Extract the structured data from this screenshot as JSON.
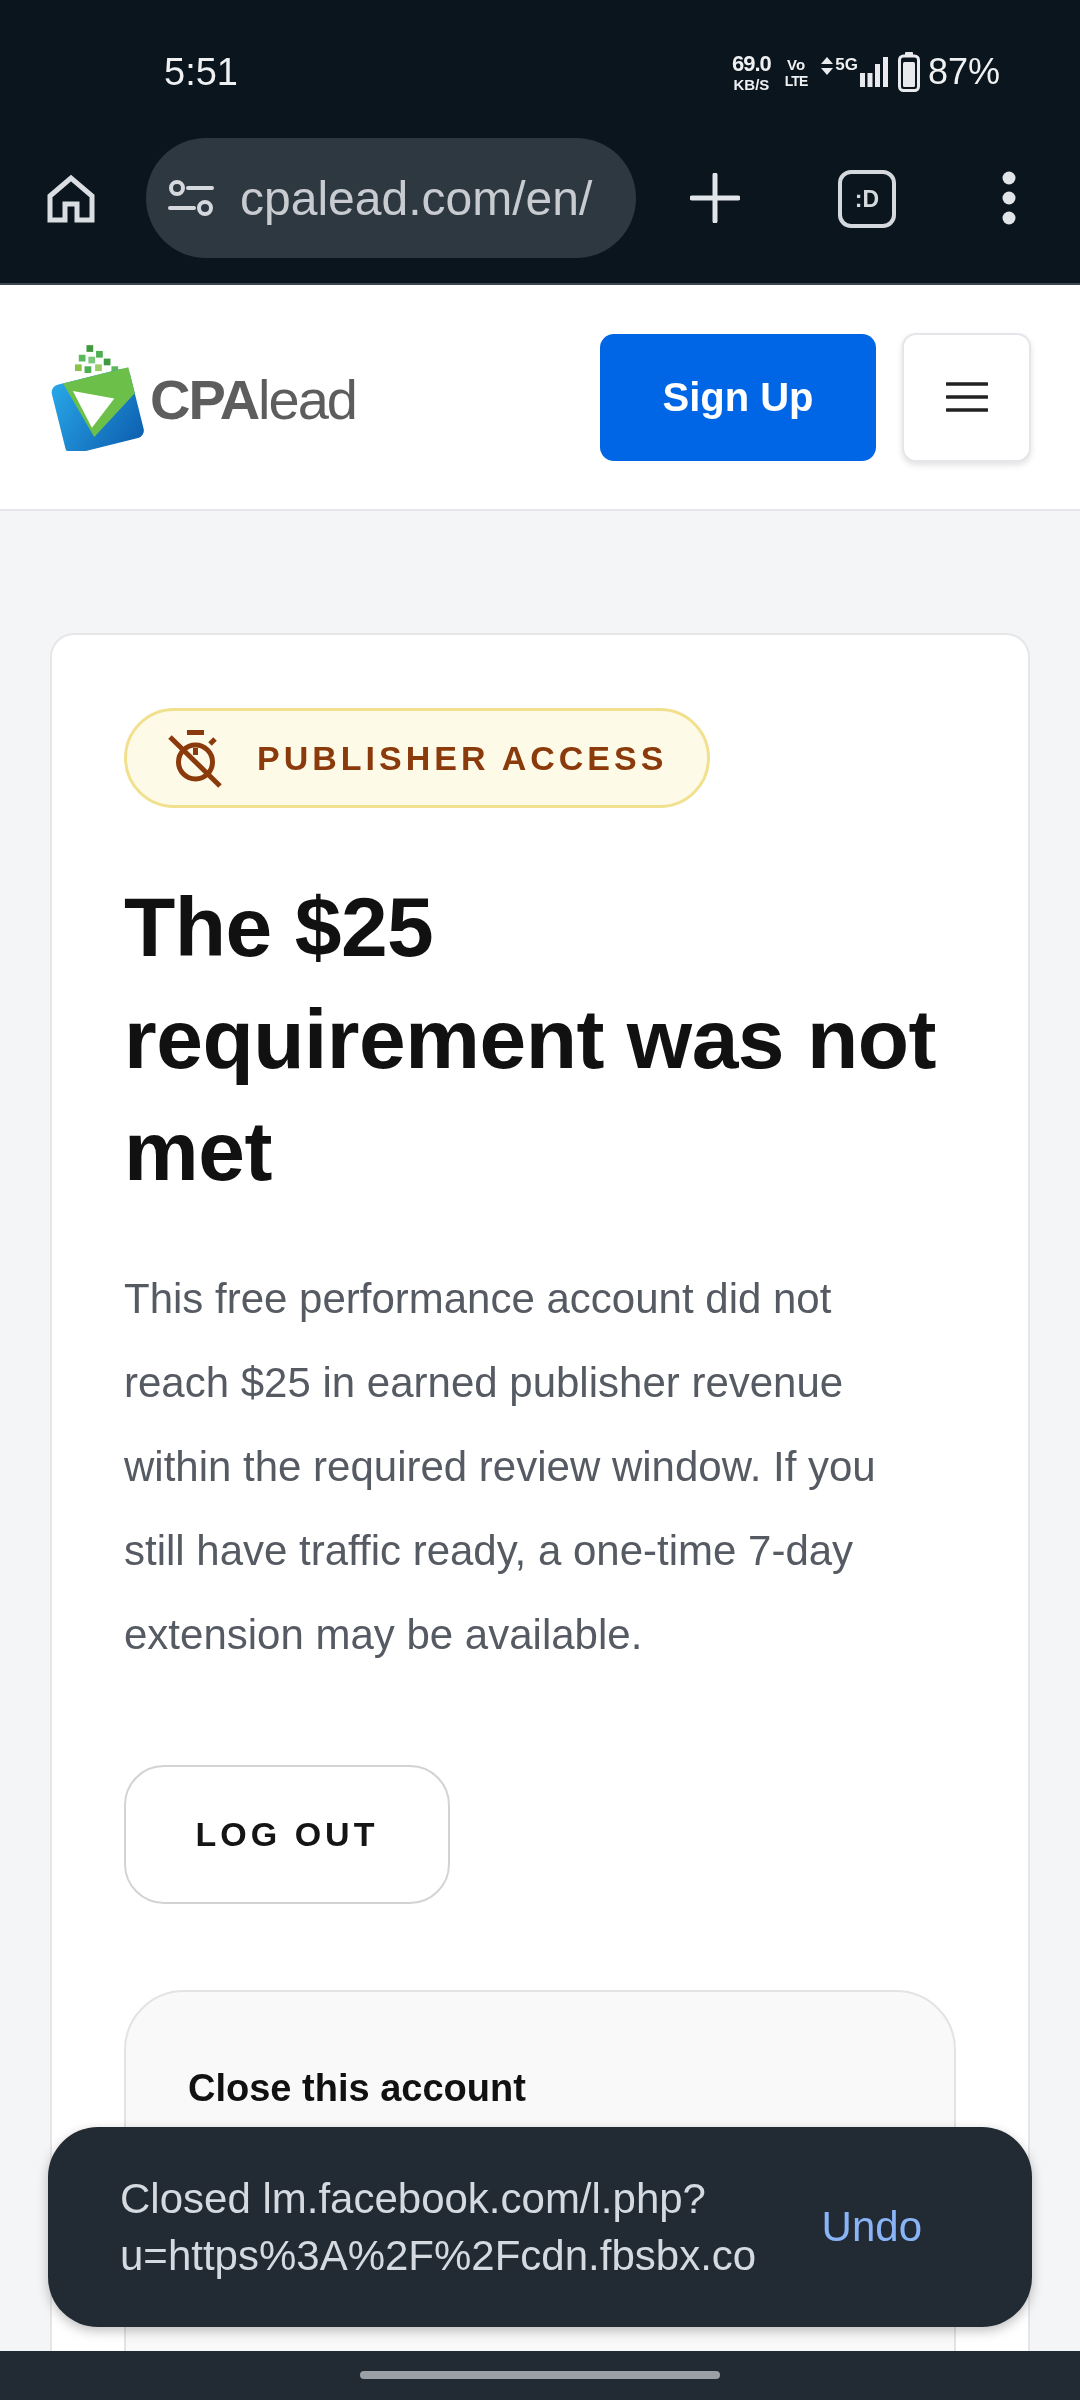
{
  "status_bar": {
    "time": "5:51",
    "speed": "69.0",
    "speed_unit": "KB/S",
    "volte": [
      "Vo",
      "LTE"
    ],
    "network": "5G",
    "battery": "87%"
  },
  "browser_toolbar": {
    "url": "cpalead.com/en/",
    "tab_switcher": ":D"
  },
  "header": {
    "logo": "**CPA**lead",
    "sign_up": "Sign Up"
  },
  "card": {
    "badge": "PUBLISHER ACCESS",
    "title_lines": [
      "The $25",
      "requirement was not",
      "met"
    ],
    "body": "This free performance account did not reach $25 in earned publisher revenue within the required review window. If you still have traffic ready, a one-time 7-day extension may be available.",
    "log_out": "LOG OUT",
    "close_section": {
      "title": "Close this account"
    }
  },
  "snackbar": {
    "message_lines": [
      "Closed lm.facebook.com/l.php?",
      "u=https%3A%2F%2Fcdn.fbsbx.co"
    ],
    "action": "Undo"
  }
}
